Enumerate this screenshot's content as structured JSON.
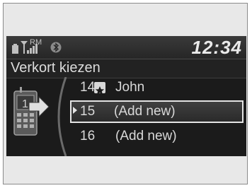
{
  "status": {
    "battery_icon": "battery-icon",
    "signal_icon": "signal-strength-icon",
    "roaming_label": "RM",
    "bluetooth_icon": "bluetooth-icon",
    "clock": "12:34"
  },
  "header": {
    "title": "Verkort kiezen"
  },
  "speed_dial": {
    "icon": "phone-speed-dial-icon",
    "entries": [
      {
        "number": "14",
        "icon": "star-icon",
        "name": "John"
      },
      {
        "number": "15",
        "name": "(Add new)",
        "selected": true
      },
      {
        "number": "16",
        "name": "(Add new)"
      }
    ]
  }
}
